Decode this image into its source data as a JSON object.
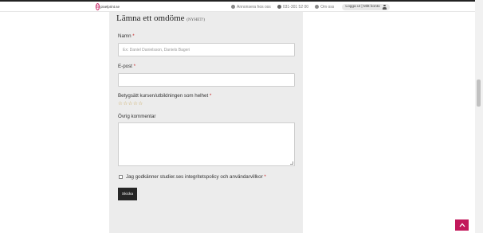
{
  "header": {
    "logo_text": "pixelprint.se",
    "nav": [
      {
        "icon": "globe-icon",
        "label": "Annonsera hos oss"
      },
      {
        "icon": "phone-icon",
        "label": "031-301 52 00"
      },
      {
        "icon": "info-icon",
        "label": "Om oss"
      }
    ],
    "login_label": "Logga ut | Mitt konto"
  },
  "form": {
    "title": "Lämna ett omdöme",
    "title_tag": "(NYHET!)",
    "name_label": "Namn",
    "name_placeholder": "Ex: Daniel Danielsson, Daniels Bageri",
    "email_label": "E-post",
    "email_value": "",
    "rating_label": "Betygsätt kursen/utbildningen som helhet",
    "rating_stars": [
      "☆",
      "☆",
      "☆",
      "☆",
      "☆"
    ],
    "rating_value": 0,
    "rating_max": 5,
    "comment_label": "Övrig kommentar",
    "comment_value": "",
    "consent_label": "Jag godkänner studier.ses integritetspolicy och användarvillkor",
    "required_mark": "*",
    "submit_label": "Skicka"
  },
  "colors": {
    "accent": "#c2185b",
    "panel_bg": "#ececec",
    "button_bg": "#262626",
    "star": "#c7a14a"
  }
}
